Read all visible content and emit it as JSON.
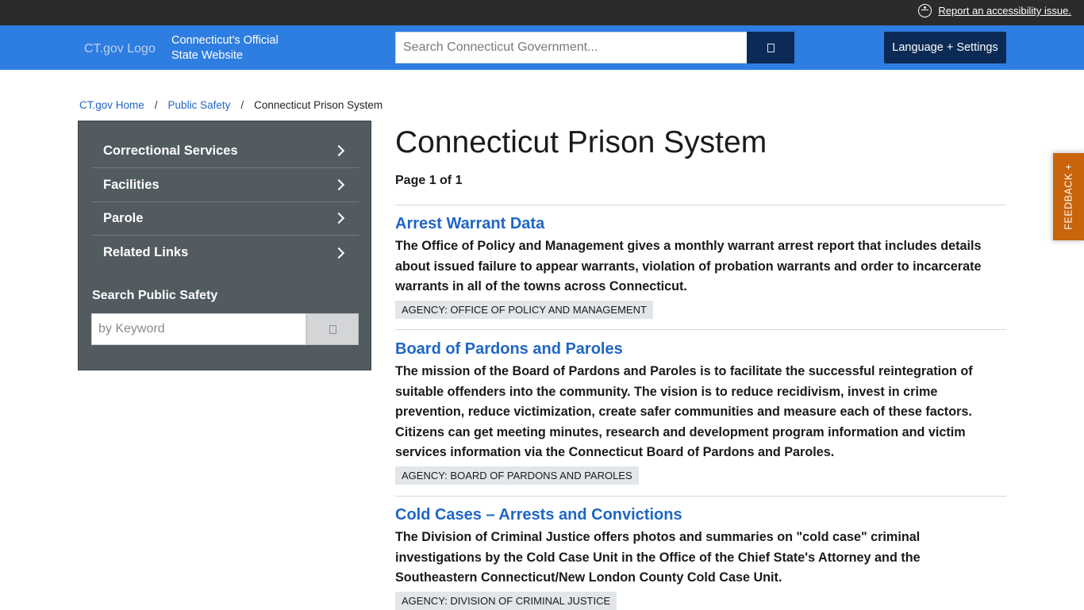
{
  "topbar": {
    "accessibility_link": "Report an accessibility issue.",
    "accessibility_icon": "accessibility-icon"
  },
  "header": {
    "logo_alt": "CT.gov Logo",
    "tagline": "Connecticut's Official State Website",
    "search_placeholder": "Search Connecticut Government...",
    "search_icon": "search-icon",
    "language_button": "Language + Settings",
    "colors": {
      "header": "#2e7de0",
      "topbar": "#2b2b2b",
      "buttons": "#0b2a55"
    }
  },
  "breadcrumb": {
    "items": [
      "CT.gov Home",
      "Public Safety"
    ],
    "separator": "/",
    "current": "Connecticut Prison System"
  },
  "sidebar": {
    "items": [
      {
        "label": "Correctional Services"
      },
      {
        "label": "Facilities"
      },
      {
        "label": "Parole"
      },
      {
        "label": "Related Links"
      }
    ],
    "search_label": "Search Public Safety",
    "search_placeholder": "by Keyword",
    "background": "#525b60"
  },
  "main": {
    "title": "Connecticut Prison System",
    "page_count": "Page 1 of 1",
    "results": [
      {
        "title": "Arrest Warrant Data",
        "description": "The Office of Policy and Management gives a monthly warrant arrest report that includes details about issued failure to appear warrants, violation of probation warrants and order to incarcerate warrants in all of the towns across Connecticut.",
        "agency": "AGENCY: OFFICE OF POLICY AND MANAGEMENT"
      },
      {
        "title": "Board of Pardons and Paroles",
        "description": "The mission of the Board of Pardons and Paroles is to facilitate the successful reintegration of suitable offenders into the community. The vision is to reduce recidivism, invest in crime prevention, reduce victimization, create safer communities and measure each of these factors. Citizens can get meeting minutes, research and development program information and victim services information via the Connecticut Board of Pardons and Paroles.",
        "agency": "AGENCY: BOARD OF PARDONS AND PAROLES"
      },
      {
        "title": "Cold Cases – Arrests and Convictions",
        "description": "The Division of Criminal Justice offers photos and summaries on \"cold case\" criminal investigations by the Cold Case Unit in the Office of the Chief State's Attorney and the Southeastern Connecticut/New London County Cold Case Unit.",
        "agency": "AGENCY: DIVISION OF CRIMINAL JUSTICE"
      }
    ],
    "link_color": "#1f66c6"
  },
  "feedback": {
    "label": "FEEDBACK +",
    "color": "#c9640c"
  }
}
